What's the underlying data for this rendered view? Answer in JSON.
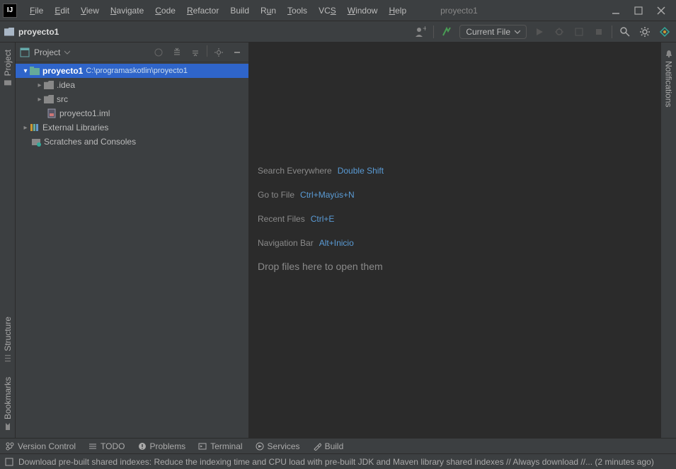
{
  "window": {
    "title": "proyecto1"
  },
  "menu": {
    "file": "File",
    "edit": "Edit",
    "view": "View",
    "navigate": "Navigate",
    "code": "Code",
    "refactor": "Refactor",
    "build": "Build",
    "run": "Run",
    "tools": "Tools",
    "vcs": "VCS",
    "window": "Window",
    "help": "Help"
  },
  "breadcrumb": {
    "project": "proyecto1"
  },
  "toolbar": {
    "run_selector": "Current File"
  },
  "gutter": {
    "project": "Project",
    "structure": "Structure",
    "bookmarks": "Bookmarks",
    "notifications": "Notifications"
  },
  "panel": {
    "title": "Project"
  },
  "tree": {
    "root": {
      "name": "proyecto1",
      "path": "C:\\programaskotlin\\proyecto1"
    },
    "idea": ".idea",
    "src": "src",
    "iml": "proyecto1.iml",
    "ext": "External Libraries",
    "scratches": "Scratches and Consoles"
  },
  "tips": {
    "search": {
      "label": "Search Everywhere",
      "key": "Double Shift"
    },
    "gotofile": {
      "label": "Go to File",
      "key": "Ctrl+Mayús+N"
    },
    "recent": {
      "label": "Recent Files",
      "key": "Ctrl+E"
    },
    "navbar": {
      "label": "Navigation Bar",
      "key": "Alt+Inicio"
    },
    "drop": "Drop files here to open them"
  },
  "bottom": {
    "vcs": "Version Control",
    "todo": "TODO",
    "problems": "Problems",
    "terminal": "Terminal",
    "services": "Services",
    "build": "Build"
  },
  "status": {
    "msg": "Download pre-built shared indexes: Reduce the indexing time and CPU load with pre-built JDK and Maven library shared indexes // Always download //... (2 minutes ago)"
  }
}
